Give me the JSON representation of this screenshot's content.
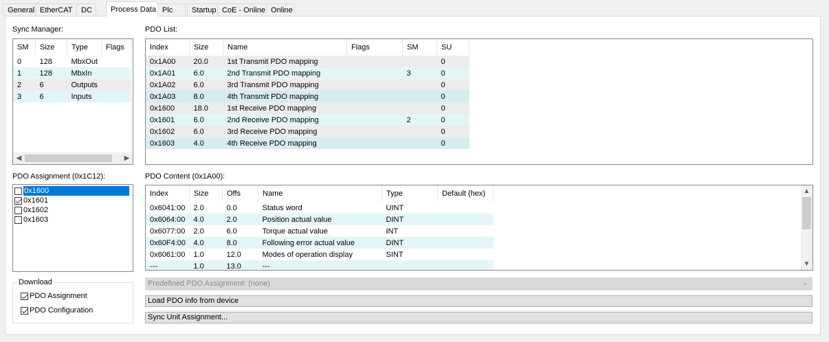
{
  "tabs": [
    {
      "label": "General"
    },
    {
      "label": "EtherCAT"
    },
    {
      "label": "DC"
    },
    {
      "label": "Process Data"
    },
    {
      "label": "Plc"
    },
    {
      "label": "Startup"
    },
    {
      "label": "CoE - Online"
    },
    {
      "label": "Online"
    }
  ],
  "active_tab": "Process Data",
  "sync_manager": {
    "label": "Sync Manager:",
    "columns": [
      "SM",
      "Size",
      "Type",
      "Flags"
    ],
    "rows": [
      [
        "0",
        "128",
        "MbxOut",
        ""
      ],
      [
        "1",
        "128",
        "MbxIn",
        ""
      ],
      [
        "2",
        "6",
        "Outputs",
        ""
      ],
      [
        "3",
        "6",
        "Inputs",
        ""
      ]
    ]
  },
  "pdo_list": {
    "label": "PDO List:",
    "columns": [
      "Index",
      "Size",
      "Name",
      "Flags",
      "SM",
      "SU"
    ],
    "rows": [
      [
        "0x1A00",
        "20.0",
        "1st Transmit PDO mapping",
        "",
        "",
        "0"
      ],
      [
        "0x1A01",
        "6.0",
        "2nd Transmit PDO mapping",
        "",
        "3",
        "0"
      ],
      [
        "0x1A02",
        "6.0",
        "3rd Transmit PDO mapping",
        "",
        "",
        "0"
      ],
      [
        "0x1A03",
        "8.0",
        "4th Transmit PDO mapping",
        "",
        "",
        "0"
      ],
      [
        "0x1600",
        "18.0",
        "1st Receive PDO mapping",
        "",
        "",
        "0"
      ],
      [
        "0x1601",
        "6.0",
        "2nd Receive PDO mapping",
        "",
        "2",
        "0"
      ],
      [
        "0x1602",
        "6.0",
        "3rd Receive PDO mapping",
        "",
        "",
        "0"
      ],
      [
        "0x1603",
        "4.0",
        "4th Receive PDO mapping",
        "",
        "",
        "0"
      ]
    ]
  },
  "pdo_assignment": {
    "label": "PDO Assignment (0x1C12):",
    "items": [
      {
        "label": "0x1600",
        "checked": false,
        "selected": true
      },
      {
        "label": "0x1601",
        "checked": true,
        "selected": false
      },
      {
        "label": "0x1602",
        "checked": false,
        "selected": false
      },
      {
        "label": "0x1603",
        "checked": false,
        "selected": false
      }
    ]
  },
  "pdo_content": {
    "label": "PDO Content (0x1A00):",
    "columns": [
      "Index",
      "Size",
      "Offs",
      "Name",
      "Type",
      "Default (hex)"
    ],
    "rows": [
      [
        "0x6041:00",
        "2.0",
        "0.0",
        "Status word",
        "UINT",
        ""
      ],
      [
        "0x6064:00",
        "4.0",
        "2.0",
        "Position actual value",
        "DINT",
        ""
      ],
      [
        "0x6077:00",
        "2.0",
        "6.0",
        "Torque actual value",
        "INT",
        ""
      ],
      [
        "0x60F4:00",
        "4.0",
        "8.0",
        "Following error actual value",
        "DINT",
        ""
      ],
      [
        "0x6061:00",
        "1.0",
        "12.0",
        "Modes of operation display",
        "SINT",
        ""
      ],
      [
        "---",
        "1.0",
        "13.0",
        "---",
        "",
        ""
      ]
    ]
  },
  "download": {
    "label": "Download",
    "pdo_assignment_label": "PDO Assignment",
    "pdo_assignment_checked": true,
    "pdo_configuration_label": "PDO Configuration",
    "pdo_configuration_checked": true
  },
  "predefined": {
    "value": "Predefined PDO Assignment: (none)"
  },
  "buttons": {
    "load_pdo_info": "Load PDO info from device",
    "sync_unit_assignment": "Sync Unit Assignment..."
  },
  "icons": {
    "scroll_left": "◀",
    "scroll_right": "▶",
    "scroll_up": "▲",
    "scroll_down": "▼",
    "combo_arrow": "⌄"
  }
}
